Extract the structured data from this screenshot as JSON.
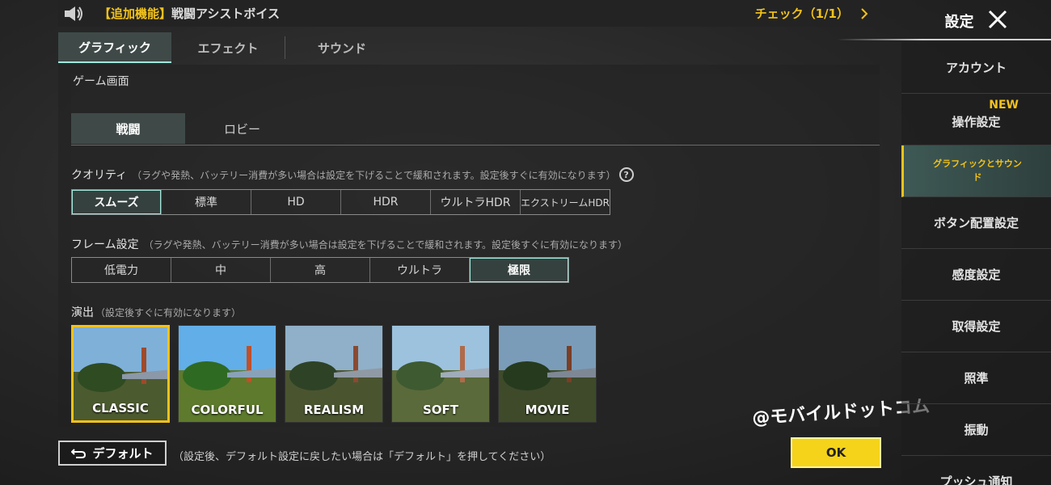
{
  "announcement": {
    "tag": "【追加機能】",
    "text": "戦闘アシストボイス",
    "check": "チェック（1/1）"
  },
  "settings_header": {
    "title": "設定"
  },
  "top_tabs": [
    {
      "label": "グラフィック",
      "active": true
    },
    {
      "label": "エフェクト",
      "active": false
    },
    {
      "label": "サウンド",
      "active": false
    }
  ],
  "section": {
    "title": "ゲーム画面"
  },
  "sub_tabs": [
    {
      "label": "戦闘",
      "active": true
    },
    {
      "label": "ロビー",
      "active": false
    }
  ],
  "quality": {
    "label": "クオリティ",
    "note": "（ラグや発熱、バッテリー消費が多い場合は設定を下げることで緩和されます。設定後すぐに有効になります）",
    "options": [
      "スムーズ",
      "標準",
      "HD",
      "HDR",
      "ウルトラHDR",
      "エクストリームHDR"
    ],
    "selected": "スムーズ"
  },
  "frame": {
    "label": "フレーム設定",
    "note": "（ラグや発熱、バッテリー消費が多い場合は設定を下げることで緩和されます。設定後すぐに有効になります）",
    "options": [
      "低電力",
      "中",
      "高",
      "ウルトラ",
      "極限"
    ],
    "selected": "極限"
  },
  "style": {
    "label": "演出",
    "note": "（設定後すぐに有効になります）",
    "options": [
      "CLASSIC",
      "COLORFUL",
      "REALISM",
      "SOFT",
      "MOVIE"
    ],
    "selected": "CLASSIC"
  },
  "bottom": {
    "default_label": "デフォルト",
    "default_note": "（設定後、デフォルト設定に戻したい場合は「デフォルト」を押してください）",
    "ok_label": "OK",
    "watermark": "@モバイルドットコム"
  },
  "sidebar": {
    "items": [
      {
        "label": "アカウント",
        "active": false
      },
      {
        "label": "操作設定",
        "active": false,
        "badge": "NEW"
      },
      {
        "label": "グラフィックとサウンド",
        "active": true
      },
      {
        "label": "ボタン配置設定",
        "active": false
      },
      {
        "label": "感度設定",
        "active": false
      },
      {
        "label": "取得設定",
        "active": false
      },
      {
        "label": "照準",
        "active": false
      },
      {
        "label": "振動",
        "active": false
      },
      {
        "label": "プッシュ通知",
        "active": false
      }
    ]
  },
  "colors": {
    "accent_yellow": "#f2c21b",
    "active_teal": "#3f4a48",
    "highlight_teal": "#9fe8dc"
  }
}
